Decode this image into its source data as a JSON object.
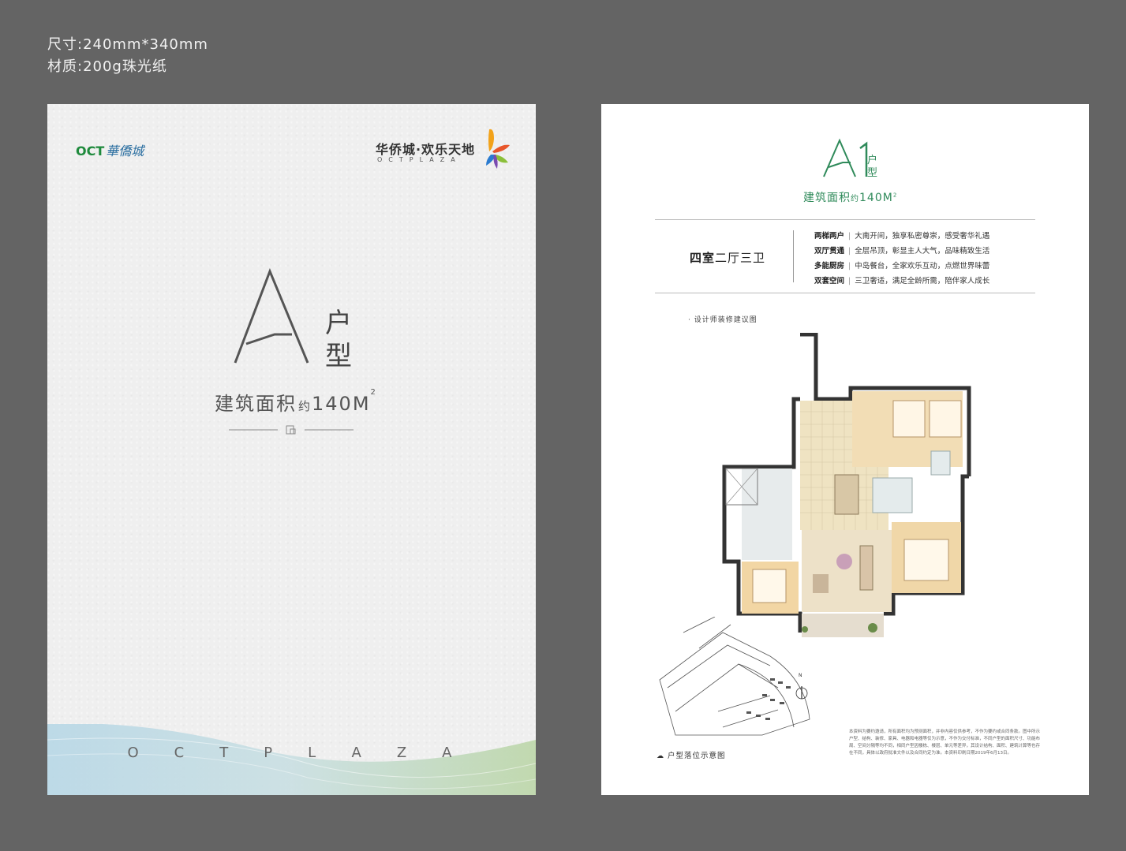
{
  "spec": {
    "size": "尺寸:240mm*340mm",
    "material": "材质:200g珠光纸"
  },
  "left_page": {
    "brand_oct": "OCT",
    "brand_oct_script": "華僑城",
    "brand_plaza_cn": "华侨城·欢乐天地",
    "brand_plaza_en": "OCTPLAZA",
    "big_letter": "A",
    "type_char_1": "户",
    "type_char_2": "型",
    "area_prefix": "建筑面积",
    "area_approx": "约",
    "area_value": "140M",
    "area_sup": "2",
    "bottom_wordmark": "OCTPLAZA"
  },
  "right_page": {
    "unit_name": "A1",
    "type_char_1": "户",
    "type_char_2": "型",
    "area_prefix": "建筑面积",
    "area_approx": "约",
    "area_value": "140M",
    "area_sup": "2",
    "rooms_bold": "四室",
    "rooms_rest": "二厅三卫",
    "features": [
      {
        "key": "两梯两户",
        "text": "大南开间，独享私密尊崇，感受奢华礼遇"
      },
      {
        "key": "双厅贯通",
        "text": "全层吊顶，彰显主人大气，品味精致生活"
      },
      {
        "key": "多能厨房",
        "text": "中岛餐台，全家欢乐互动，点燃世界味蕾"
      },
      {
        "key": "双套空间",
        "text": "三卫奢适，满足全龄所需，陪伴家人成长"
      }
    ],
    "plan_caption": "· 设计师装修建议图",
    "site_caption": "户型落位示意图",
    "north_label": "N",
    "disclaimer": "本资料为要约邀请，所有面积均为预测面积，并非内容仅供参考，不作为要约或合同条款。图中所示户型、结构、装修、家具、电器和电器等仅为示意，不作为交付标准，不同户型的面积尺寸、功能布局、空间分隔等均不同，相同户型因楼栋、楼层、单元等差异，其设计结构、面积、建筑计算等也存在不同，具体以政府批准文件以及合同约定为准。本资料印刷日期2019年6月13日。"
  },
  "colors": {
    "background": "#646464",
    "green": "#2f8a5a",
    "text_dark": "#444444"
  }
}
